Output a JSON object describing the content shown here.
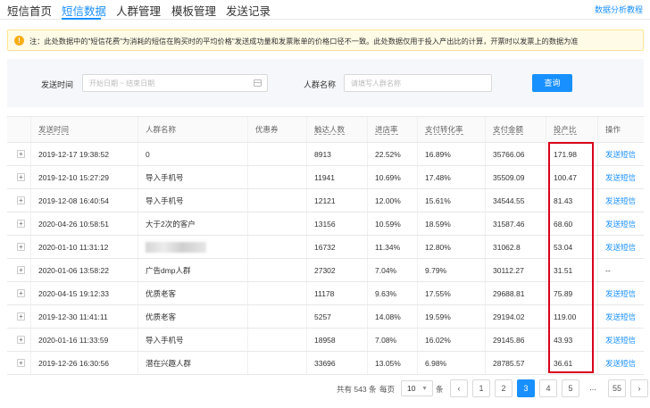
{
  "nav": {
    "tabs": [
      {
        "label": "短信首页"
      },
      {
        "label": "短信数据"
      },
      {
        "label": "人群管理"
      },
      {
        "label": "模板管理"
      },
      {
        "label": "发送记录"
      }
    ],
    "active_tab": "短信数据",
    "help_link": "数据分析教程"
  },
  "notice": {
    "text": "注：此处数据中的\"短信花费\"为消耗的短信在购买时的平均价格\"发送成功量和发票账单的价格口径不一致。此处数据仅用于投入产出比的计算，开票时以发票上的数据为准"
  },
  "filter": {
    "send_time_label": "发送时间",
    "date_placeholder": "开始日期 ~ 结束日期",
    "crowd_label": "人群名称",
    "crowd_placeholder": "请填写人群名称",
    "query_button": "查询"
  },
  "table": {
    "columns": [
      "发送时间",
      "人群名称",
      "优惠券",
      "触达人数",
      "进店率",
      "支付转化率",
      "支付金额",
      "投产比",
      "操作"
    ],
    "rows": [
      {
        "time": "2019-12-17 19:38:52",
        "crowd": "0",
        "coupon": "",
        "reach": "8913",
        "store_rate": "22.52%",
        "pay_rate": "16.89%",
        "amount": "35766.06",
        "roi": "171.98",
        "action": "发送短信"
      },
      {
        "time": "2019-12-10 15:27:29",
        "crowd": "导入手机号",
        "coupon": "",
        "reach": "11941",
        "store_rate": "10.69%",
        "pay_rate": "17.48%",
        "amount": "35509.09",
        "roi": "100.47",
        "action": "发送短信"
      },
      {
        "time": "2019-12-08 16:40:54",
        "crowd": "导入手机号",
        "coupon": "",
        "reach": "12121",
        "store_rate": "12.00%",
        "pay_rate": "15.61%",
        "amount": "34544.55",
        "roi": "81.43",
        "action": "发送短信"
      },
      {
        "time": "2020-04-26 10:58:51",
        "crowd": "大于2次的客户",
        "coupon": "",
        "reach": "13156",
        "store_rate": "10.59%",
        "pay_rate": "18.59%",
        "amount": "31587.46",
        "roi": "68.60",
        "action": "发送短信"
      },
      {
        "time": "2020-01-10 11:31:12",
        "crowd": "",
        "coupon": "",
        "reach": "16732",
        "store_rate": "11.34%",
        "pay_rate": "12.80%",
        "amount": "31062.8",
        "roi": "53.04",
        "action": "发送短信"
      },
      {
        "time": "2020-01-06 13:58:22",
        "crowd": "广告dmp人群",
        "coupon": "",
        "reach": "27302",
        "store_rate": "7.04%",
        "pay_rate": "9.79%",
        "amount": "30112.27",
        "roi": "31.51",
        "action": "--"
      },
      {
        "time": "2020-04-15 19:12:33",
        "crowd": "优质老客",
        "coupon": "",
        "reach": "11178",
        "store_rate": "9.63%",
        "pay_rate": "17.55%",
        "amount": "29688.81",
        "roi": "75.89",
        "action": "发送短信"
      },
      {
        "time": "2019-12-30 11:41:11",
        "crowd": "优质老客",
        "coupon": "",
        "reach": "5257",
        "store_rate": "14.08%",
        "pay_rate": "19.59%",
        "amount": "29194.02",
        "roi": "119.00",
        "action": "发送短信"
      },
      {
        "time": "2020-01-16 11:33:59",
        "crowd": "导入手机号",
        "coupon": "",
        "reach": "18958",
        "store_rate": "7.08%",
        "pay_rate": "16.02%",
        "amount": "29145.86",
        "roi": "43.93",
        "action": "发送短信"
      },
      {
        "time": "2019-12-26 16:30:56",
        "crowd": "潜在兴趣人群",
        "coupon": "",
        "reach": "33696",
        "store_rate": "13.05%",
        "pay_rate": "6.98%",
        "amount": "28785.57",
        "roi": "36.61",
        "action": "发送短信"
      }
    ]
  },
  "pagination": {
    "total_prefix": "共有",
    "total": "543",
    "total_suffix": "条",
    "per_page_label": "每页",
    "per_page": "10",
    "per_page_unit": "条",
    "prev": "‹",
    "next": "›",
    "pages": [
      "1",
      "2",
      "3",
      "4",
      "5",
      "...",
      "55"
    ],
    "current": "3"
  },
  "accent_color": "#1890ff",
  "highlight_color": "#d9001b"
}
